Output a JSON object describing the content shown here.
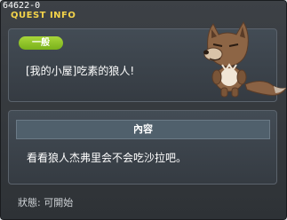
{
  "window": {
    "quest_id": "64622-0",
    "title": "QUEST INFO"
  },
  "quest": {
    "category_badge": "一般",
    "name": "[我的小屋]吃素的狼人!",
    "npc_icon": "wolf-npc-sprite"
  },
  "content": {
    "header": "內容",
    "text": "看看狼人杰弗里会不会吃沙拉吧。"
  },
  "status": {
    "text": "狀態: 可開始"
  },
  "colors": {
    "title": "#f3d34a",
    "badge": "#8fc52a",
    "panel": "#3b424a"
  }
}
